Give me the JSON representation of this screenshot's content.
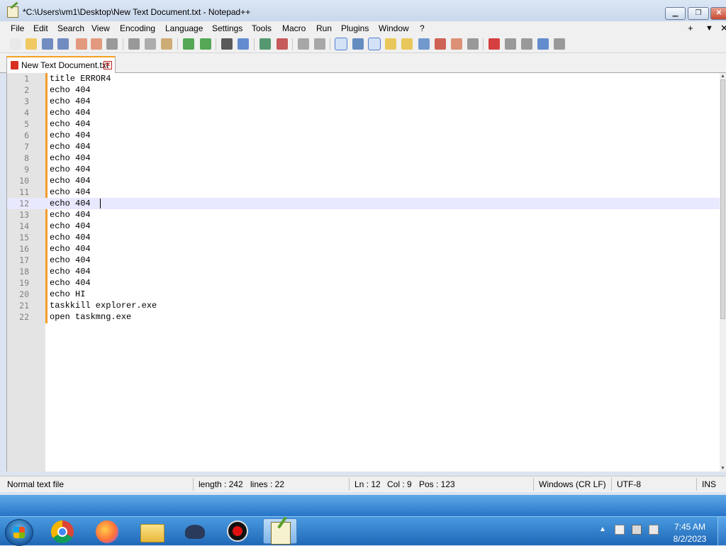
{
  "window": {
    "title": "*C:\\Users\\vm1\\Desktop\\New Text Document.txt - Notepad++",
    "icon": "notepad-plus-plus-icon",
    "minimize_icon": "minimize-icon",
    "maximize_icon": "restore-icon",
    "close_icon": "close-icon"
  },
  "menu": {
    "items": [
      "File",
      "Edit",
      "Search",
      "View",
      "Encoding",
      "Language",
      "Settings",
      "Tools",
      "Macro",
      "Run",
      "Plugins",
      "Window",
      "?"
    ],
    "right": [
      "+",
      "▼",
      "✕"
    ]
  },
  "toolbar": {
    "buttons": [
      {
        "icon": "new-file-icon",
        "color": "#e8e8e8"
      },
      {
        "icon": "open-file-icon",
        "color": "#f0c24a"
      },
      {
        "icon": "save-icon",
        "color": "#5a7ab8"
      },
      {
        "icon": "save-all-icon",
        "color": "#5a7ab8"
      },
      {
        "icon": "close-icon",
        "color": "#e08a6a"
      },
      {
        "icon": "close-all-icon",
        "color": "#e08a6a"
      },
      {
        "icon": "print-icon",
        "color": "#8a8a8a"
      },
      {
        "icon": "cut-icon",
        "color": "#8a8a8a"
      },
      {
        "icon": "copy-icon",
        "color": "#a0a0a0"
      },
      {
        "icon": "paste-icon",
        "color": "#c8a060"
      },
      {
        "icon": "undo-icon",
        "color": "#3a9a3a"
      },
      {
        "icon": "redo-icon",
        "color": "#3a9a3a"
      },
      {
        "icon": "find-icon",
        "color": "#404040"
      },
      {
        "icon": "replace-icon",
        "color": "#4a7ac8"
      },
      {
        "icon": "zoom-in-icon",
        "color": "#3a8a5a"
      },
      {
        "icon": "zoom-out-icon",
        "color": "#c04040"
      },
      {
        "icon": "sync-vertical-icon",
        "color": "#9a9a9a"
      },
      {
        "icon": "sync-horizontal-icon",
        "color": "#9a9a9a"
      },
      {
        "icon": "word-wrap-icon",
        "color": "#5a6a8a"
      },
      {
        "icon": "show-all-characters-icon",
        "color": "#4a7ab8"
      },
      {
        "icon": "indent-guide-icon",
        "color": "#3a5a9a"
      },
      {
        "icon": "user-defined-language-icon",
        "color": "#e8c040"
      },
      {
        "icon": "document-map-icon",
        "color": "#e8c040"
      },
      {
        "icon": "function-list-icon",
        "color": "#5a8ac8"
      },
      {
        "icon": "folder-as-workspace-icon",
        "color": "#c84a3a"
      },
      {
        "icon": "monitoring-icon",
        "color": "#d88060"
      },
      {
        "icon": "eye-icon",
        "color": "#8a8a8a"
      },
      {
        "icon": "record-macro-icon",
        "color": "#d02020"
      },
      {
        "icon": "stop-recording-icon",
        "color": "#8a8a8a"
      },
      {
        "icon": "playback-icon",
        "color": "#8a8a8a"
      },
      {
        "icon": "run-macro-multiple-icon",
        "color": "#4a7ac8"
      },
      {
        "icon": "save-macro-icon",
        "color": "#8a8a8a"
      }
    ]
  },
  "tab": {
    "label": "New Text Document.txt",
    "icon": "unsaved-file-icon",
    "close_icon": "tab-close-icon"
  },
  "editor": {
    "current_line": 12,
    "lines": [
      {
        "n": "1",
        "text": "title ERROR4"
      },
      {
        "n": "2",
        "text": "echo 404"
      },
      {
        "n": "3",
        "text": "echo 404"
      },
      {
        "n": "4",
        "text": "echo 404"
      },
      {
        "n": "5",
        "text": "echo 404"
      },
      {
        "n": "6",
        "text": "echo 404"
      },
      {
        "n": "7",
        "text": "echo 404"
      },
      {
        "n": "8",
        "text": "echo 404"
      },
      {
        "n": "9",
        "text": "echo 404"
      },
      {
        "n": "10",
        "text": "echo 404"
      },
      {
        "n": "11",
        "text": "echo 404"
      },
      {
        "n": "12",
        "text": "echo 404"
      },
      {
        "n": "13",
        "text": "echo 404"
      },
      {
        "n": "14",
        "text": "echo 404"
      },
      {
        "n": "15",
        "text": "echo 404"
      },
      {
        "n": "16",
        "text": "echo 404"
      },
      {
        "n": "17",
        "text": "echo 404"
      },
      {
        "n": "18",
        "text": "echo 404"
      },
      {
        "n": "19",
        "text": "echo 404"
      },
      {
        "n": "20",
        "text": "echo HI"
      },
      {
        "n": "21",
        "text": "taskkill explorer.exe"
      },
      {
        "n": "22",
        "text": "open taskmng.exe"
      }
    ]
  },
  "status": {
    "file_type": "Normal text file",
    "length": "length : 242",
    "lines": "lines : 22",
    "ln": "Ln : 12",
    "col": "Col : 9",
    "pos": "Pos : 123",
    "eol": "Windows (CR LF)",
    "encoding": "UTF-8",
    "mode": "INS"
  },
  "taskbar": {
    "apps": [
      "chrome-icon",
      "firefox-icon",
      "file-explorer-icon",
      "cat-app-icon",
      "screen-recorder-icon",
      "notepad-plus-plus-icon"
    ],
    "tray": {
      "show_hidden_icon": "chevron-up-icon",
      "icons": [
        "action-center-warning-icon",
        "network-icon",
        "volume-muted-icon"
      ]
    },
    "clock": {
      "time": "7:45 AM",
      "date": "8/2/2023"
    }
  }
}
